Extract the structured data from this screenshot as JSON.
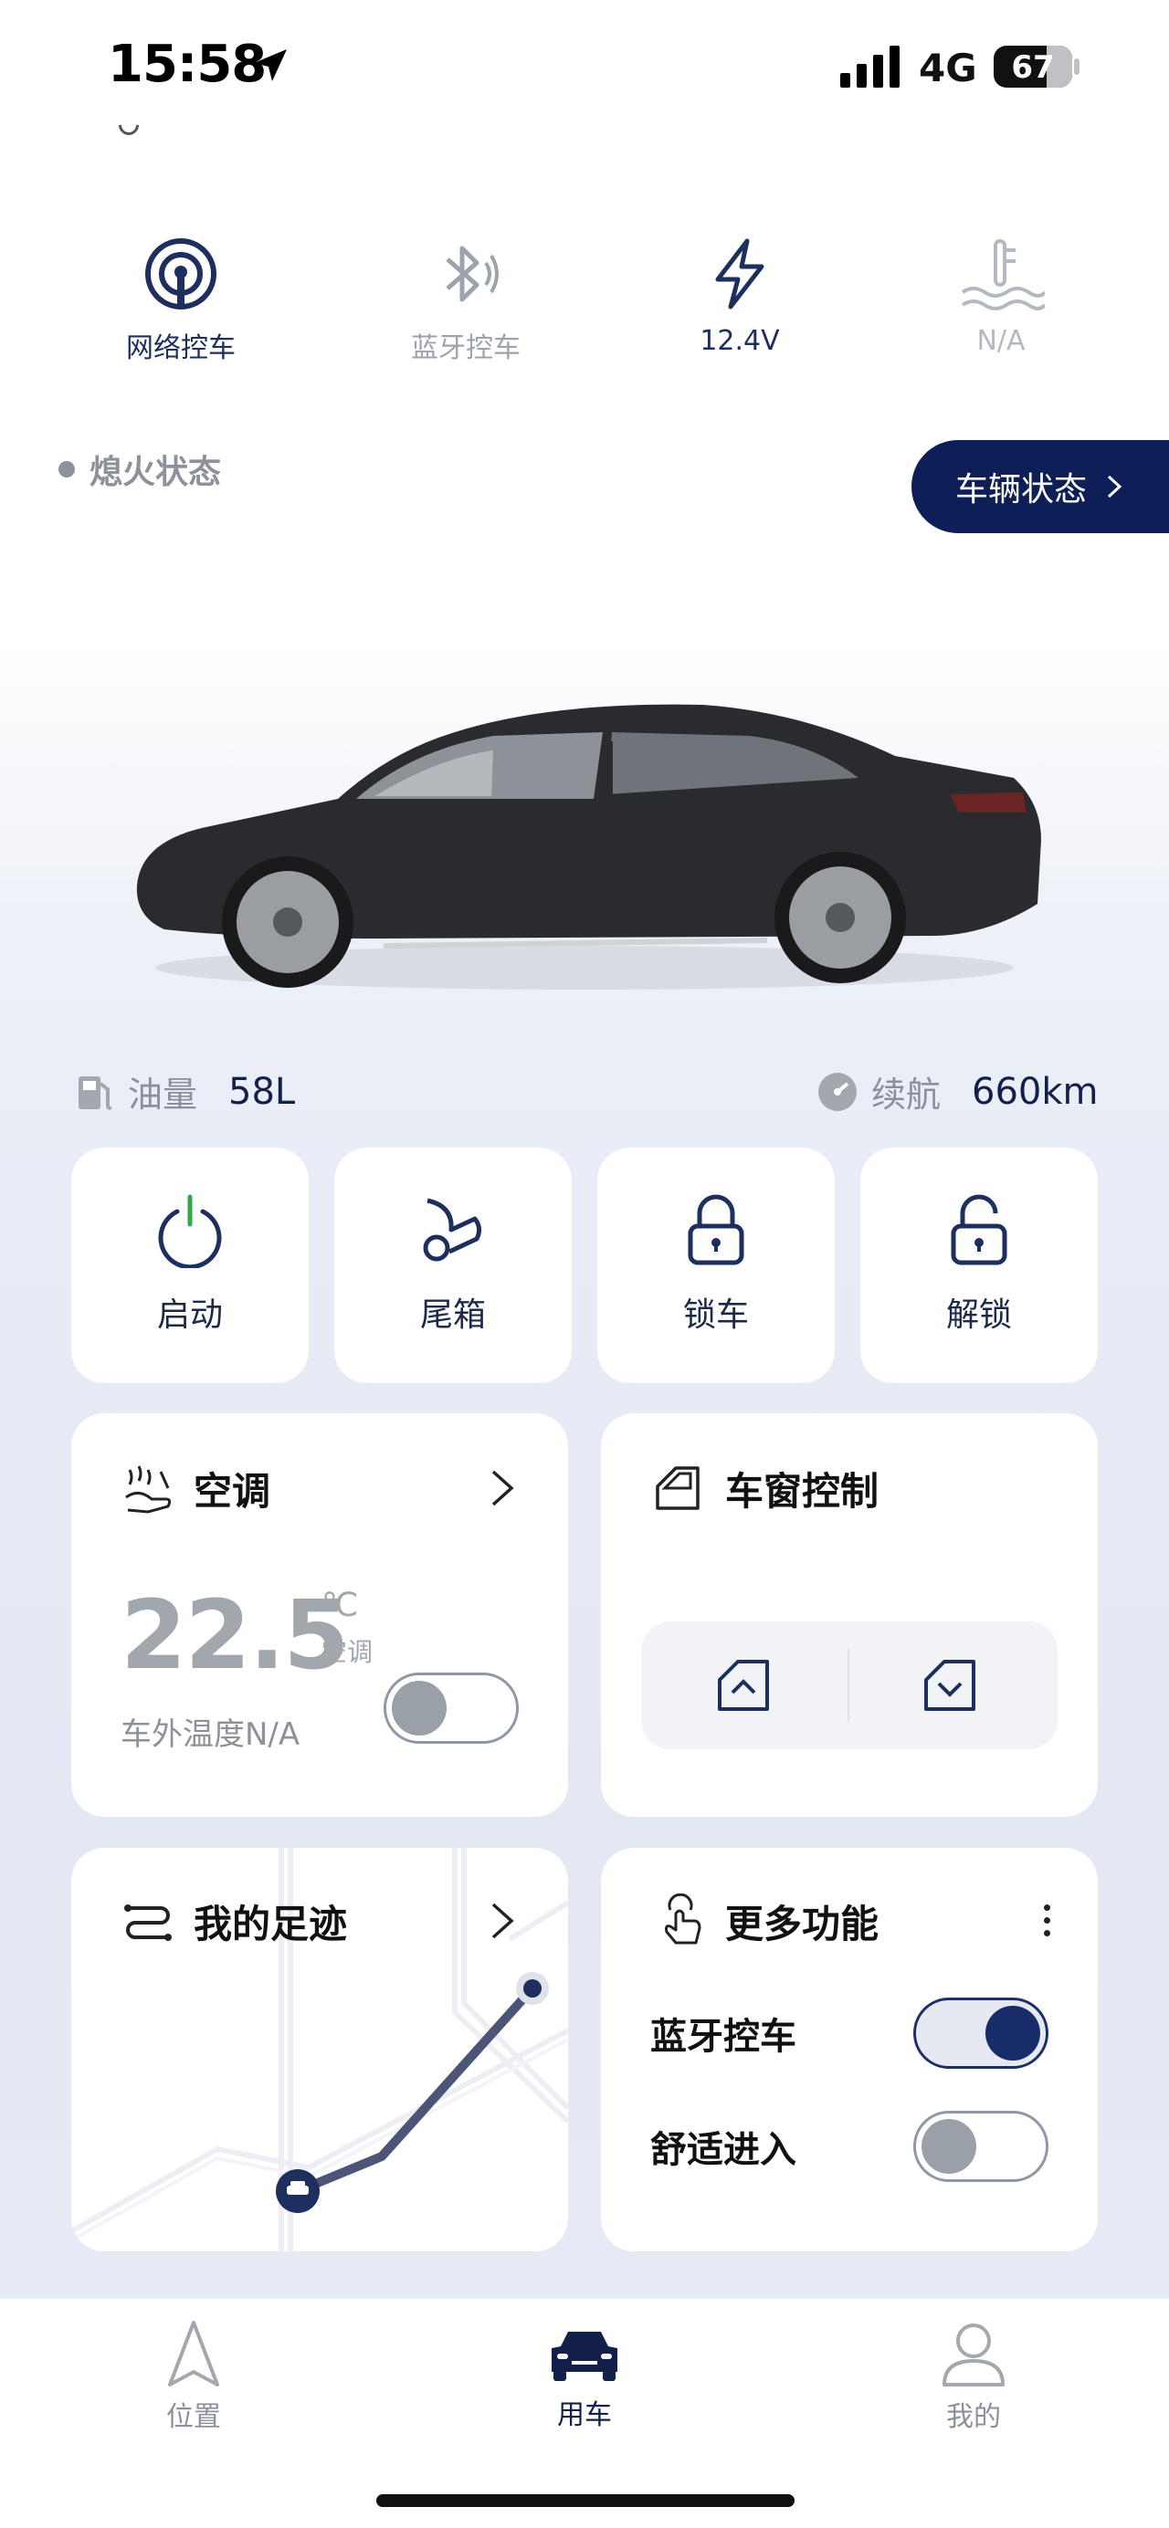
{
  "status_bar": {
    "time": "15:58",
    "network": "4G",
    "battery": "67"
  },
  "vehicle_stats": [
    {
      "label": "网络控车",
      "icon": "network-signal-icon"
    },
    {
      "label": "蓝牙控车",
      "icon": "bluetooth-icon"
    },
    {
      "label": "12.4V",
      "icon": "lightning-icon"
    },
    {
      "label": "N/A",
      "icon": "coolant-temperature-icon"
    }
  ],
  "ignition": {
    "label": "熄火状态"
  },
  "vehicle_status_button": {
    "label": "车辆状态"
  },
  "fuel": {
    "label": "油量",
    "value": "58L"
  },
  "range": {
    "label": "续航",
    "value": "660km"
  },
  "quick_actions": [
    {
      "label": "启动",
      "icon": "power-icon"
    },
    {
      "label": "尾箱",
      "icon": "trunk-icon"
    },
    {
      "label": "锁车",
      "icon": "lock-icon"
    },
    {
      "label": "解锁",
      "icon": "unlock-icon"
    }
  ],
  "climate": {
    "title": "空调",
    "temperature": "22.5",
    "unit": "℃",
    "sub": "空调",
    "outside": "车外温度N/A",
    "enabled": false
  },
  "window_control": {
    "title": "车窗控制"
  },
  "footprint": {
    "title": "我的足迹"
  },
  "more_functions": {
    "title": "更多功能",
    "items": [
      {
        "label": "蓝牙控车",
        "enabled": true
      },
      {
        "label": "舒适进入",
        "enabled": false
      }
    ]
  },
  "bottom_nav": [
    {
      "label": "位置",
      "icon": "location-arrow-icon",
      "active": false
    },
    {
      "label": "用车",
      "icon": "car-icon",
      "active": true
    },
    {
      "label": "我的",
      "icon": "profile-icon",
      "active": false
    }
  ],
  "colors": {
    "brand": "#0d1f56",
    "accent": "#182c6a",
    "muted": "#9aa0a8"
  }
}
